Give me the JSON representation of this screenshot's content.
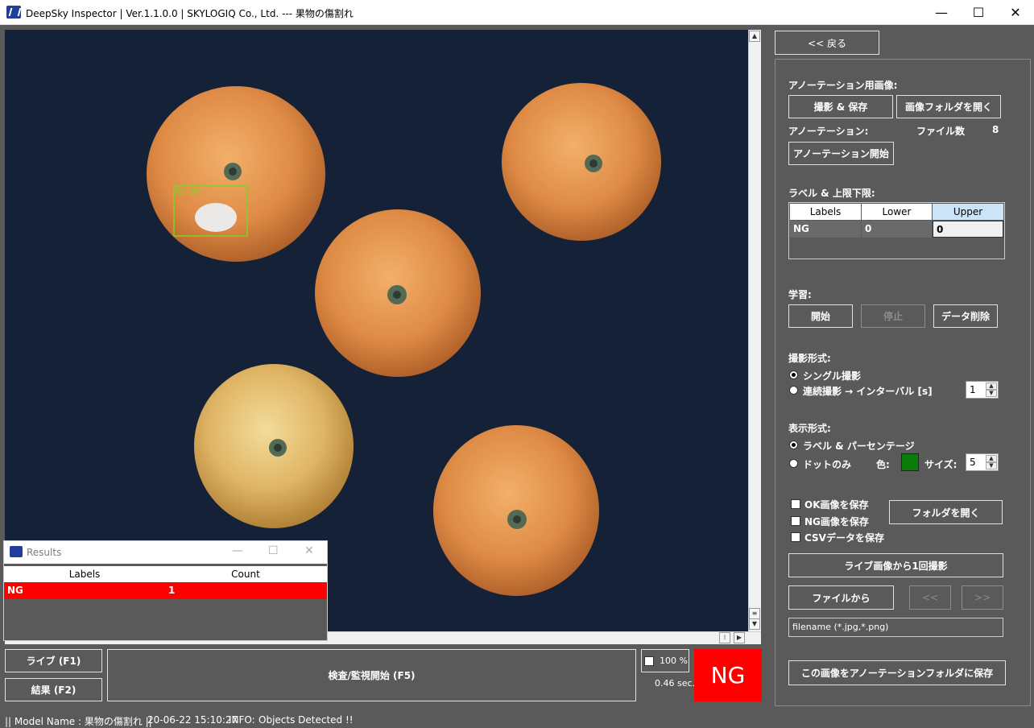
{
  "window": {
    "title": "DeepSky Inspector | Ver.1.1.0.0 | SKYLOGIQ Co., Ltd. --- 果物の傷割れ",
    "minimize": "—",
    "maximize": "☐",
    "close": "✕"
  },
  "viewer": {
    "detection_label": "NG 99",
    "colors": {
      "background": "#142137",
      "box": "#7fd321"
    }
  },
  "results": {
    "title": "Results",
    "columns": [
      "Labels",
      "Count"
    ],
    "rows": [
      {
        "label": "NG",
        "count": "1"
      }
    ]
  },
  "bottom": {
    "live_button": "ライブ (F1)",
    "result_button": "結果 (F2)",
    "inspect_button": "検査/監視開始 (F5)",
    "zoom_label": "100 %",
    "time_label": "0.46 sec.",
    "verdict": "NG"
  },
  "panel": {
    "back_button": "<< 戻る",
    "annotation_image_label": "アノーテーション用画像:",
    "capture_save_button": "撮影 & 保存",
    "open_image_folder_button": "画像フォルダを開く",
    "annotation_label": "アノーテーション:",
    "file_count_label": "ファイル数",
    "file_count_value": "8",
    "annotation_start_button": "アノーテーション開始",
    "label_limit_label": "ラベル & 上限下限:",
    "label_table": {
      "columns": [
        "Labels",
        "Lower",
        "Upper"
      ],
      "rows": [
        {
          "label": "NG",
          "lower": "0",
          "upper": "0"
        }
      ]
    },
    "learning_label": "学習:",
    "start_button": "開始",
    "stop_button": "停止",
    "delete_data_button": "データ削除",
    "capture_mode_label": "撮影形式:",
    "single_capture": "シングル撮影",
    "continuous_capture": "連続撮影 → インターバル [s]",
    "interval_value": "1",
    "display_mode_label": "表示形式:",
    "label_percentage": "ラベル & パーセンテージ",
    "dot_only": "ドットのみ",
    "color_label": "色:",
    "size_label": "サイズ:",
    "size_value": "5",
    "dot_color": "#0a7c0a",
    "save_ok": "OK画像を保存",
    "save_ng": "NG画像を保存",
    "save_csv": "CSVデータを保存",
    "open_folder_button": "フォルダを開く",
    "capture_from_live_button": "ライブ画像から1回撮影",
    "from_file_button": "ファイルから",
    "prev_button": "<<",
    "next_button": ">>",
    "filename_placeholder": "filename (*.jpg,*.png)",
    "save_to_annotation_button": "この画像をアノーテーションフォルダに保存"
  },
  "status": {
    "model_name": "|| Model Name : 果物の傷割れ ||",
    "timestamp": "20-06-22 15:10:27",
    "info_label": "INFO:",
    "info_message": "Objects Detected !!"
  }
}
